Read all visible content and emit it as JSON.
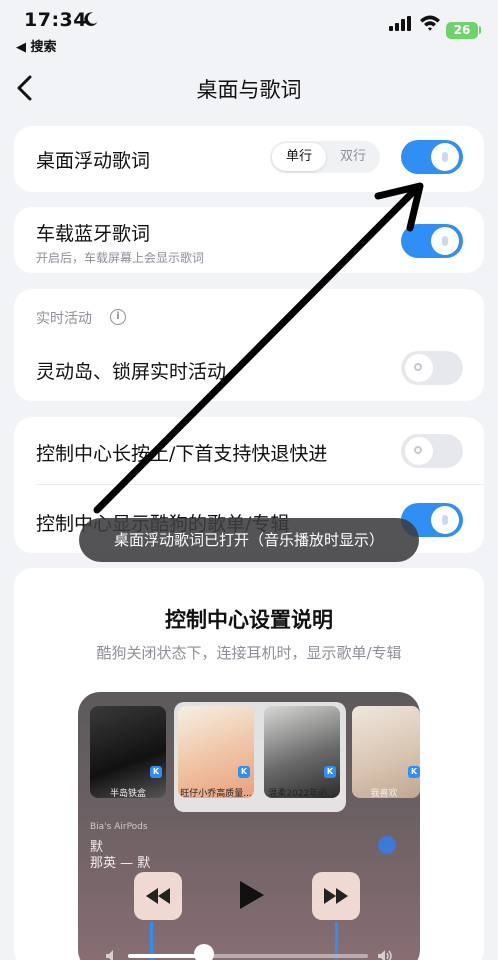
{
  "status": {
    "time": "17:34",
    "back_app": "◀ 搜索",
    "battery": "26"
  },
  "nav": {
    "title": "桌面与歌词"
  },
  "floating_lyrics": {
    "label": "桌面浮动歌词",
    "segment_options": [
      "单行",
      "双行"
    ],
    "segment_selected": "单行",
    "enabled": true
  },
  "car_lyrics": {
    "label": "车载蓝牙歌词",
    "description": "开启后，车载屏幕上会显示歌词",
    "enabled": true
  },
  "live_activity": {
    "section_label": "实时活动",
    "item_label": "灵动岛、锁屏实时活动",
    "enabled": false
  },
  "control_center": {
    "long_press_label": "控制中心长按上/下首支持快退快进",
    "long_press_enabled": false,
    "show_playlist_label": "控制中心显示酷狗的歌单/专辑",
    "show_playlist_enabled": true
  },
  "toast": {
    "text": "桌面浮动歌词已打开（音乐播放时显示）"
  },
  "explain_card": {
    "title": "控制中心设置说明",
    "subtitle": "酷狗关闭状态下，连接耳机时，显示歌单/专辑",
    "albums": [
      "半岛铁盒",
      "旺仔小乔高质量...",
      "温柔2022年必...",
      "我喜欢"
    ],
    "device": "Bia's AirPods",
    "song": "默",
    "artist": "那英 — 默"
  },
  "colors": {
    "accent": "#2f8ff5",
    "toggle_off": "#e7e8ee",
    "background": "#f2f3f7",
    "annotation_arrow": "#000000"
  }
}
